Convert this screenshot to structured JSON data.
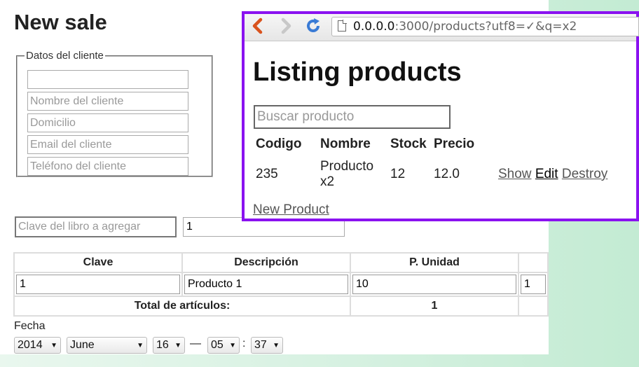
{
  "sale": {
    "title": "New sale",
    "client": {
      "legend": "Datos del cliente",
      "fields": [
        {
          "value": "",
          "placeholder": ""
        },
        {
          "value": "",
          "placeholder": "Nombre del cliente"
        },
        {
          "value": "",
          "placeholder": "Domicilio"
        },
        {
          "value": "",
          "placeholder": "Email del cliente"
        },
        {
          "value": "",
          "placeholder": "Teléfono del cliente"
        }
      ]
    },
    "book_key_placeholder": "Clave del libro a agregar",
    "quantity_value": "1",
    "table": {
      "headers": [
        "Clave",
        "Descripción",
        "P. Unidad"
      ],
      "row": [
        "1",
        "Producto 1",
        "10",
        "1"
      ],
      "total_label": "Total de artículos:",
      "total_value": "1"
    },
    "fecha": {
      "label": "Fecha",
      "year": "2014",
      "month": "June",
      "day": "16",
      "dash": "—",
      "hour": "05",
      "colon": ":",
      "minute": "37"
    }
  },
  "browser": {
    "url_host": "0.0.0.0",
    "url_rest": ":3000/products?utf8=✓&q=x2",
    "back_icon": "back-arrow-icon",
    "forward_icon": "forward-arrow-icon",
    "reload_icon": "reload-icon",
    "colors": {
      "border": "#8a12f0",
      "back": "#d9531e",
      "reload": "#3a7bd5"
    },
    "page": {
      "title": "Listing products",
      "search_placeholder": "Buscar producto",
      "columns": [
        "Codigo",
        "Nombre",
        "Stock",
        "Precio"
      ],
      "rows": [
        {
          "codigo": "235",
          "nombre": "Producto x2",
          "stock": "12",
          "precio": "12.0",
          "show": "Show",
          "edit": "Edit",
          "destroy": "Destroy"
        }
      ],
      "new_product": "New Product"
    }
  }
}
